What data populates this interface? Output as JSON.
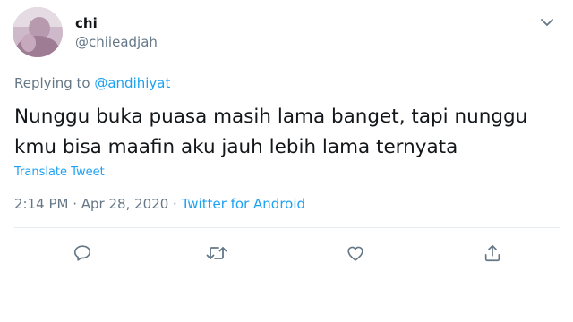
{
  "author": {
    "display_name": "chi",
    "handle": "@chiieadjah"
  },
  "reply": {
    "prefix": "Replying to ",
    "mention": "@andihiyat"
  },
  "tweet": {
    "lines": [
      "Nunggu buka puasa masih lama banget, tapi nunggu",
      "kmu bisa maafin aku jauh lebih lama ternyata"
    ],
    "translate_label": "Translate Tweet"
  },
  "meta": {
    "time": "2:14 PM",
    "separator1": " · ",
    "date": "Apr 28, 2020",
    "separator2": " · ",
    "source": "Twitter for Android"
  },
  "icons": {
    "menu": "chevron-down-icon",
    "reply": "reply-icon",
    "retweet": "retweet-icon",
    "like": "heart-icon",
    "share": "share-icon"
  },
  "colors": {
    "accent": "#1da1f2",
    "secondary_text": "#657786",
    "primary_text": "#14171a",
    "divider": "#e6ecf0"
  }
}
